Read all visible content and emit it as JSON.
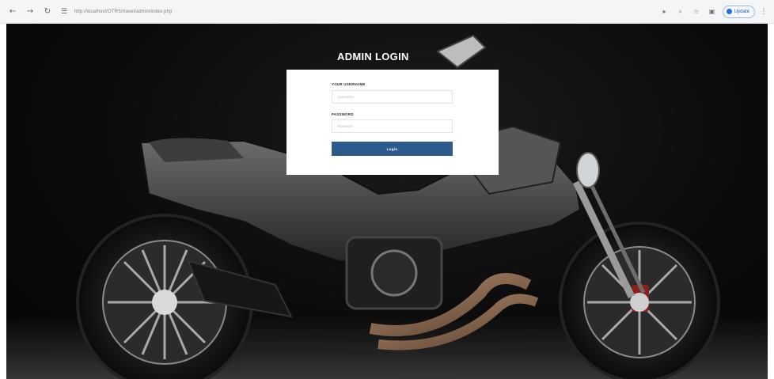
{
  "browser": {
    "url": "http://localhost/OTRS/travel/admin/index.php",
    "update_label": "Update",
    "back_icon": "arrow-left-icon",
    "forward_icon": "arrow-right-icon",
    "reload_icon": "reload-icon",
    "site_info_icon": "tune-icon"
  },
  "page": {
    "title": "ADMIN LOGIN"
  },
  "login": {
    "username_label": "YOUR USERNAME",
    "username_placeholder": "Username",
    "password_label": "PASSWORD",
    "password_placeholder": "Password",
    "submit_label": "Login"
  },
  "colors": {
    "button": "#2d5a8c",
    "background": "#0b0b0b",
    "card": "#ffffff"
  }
}
